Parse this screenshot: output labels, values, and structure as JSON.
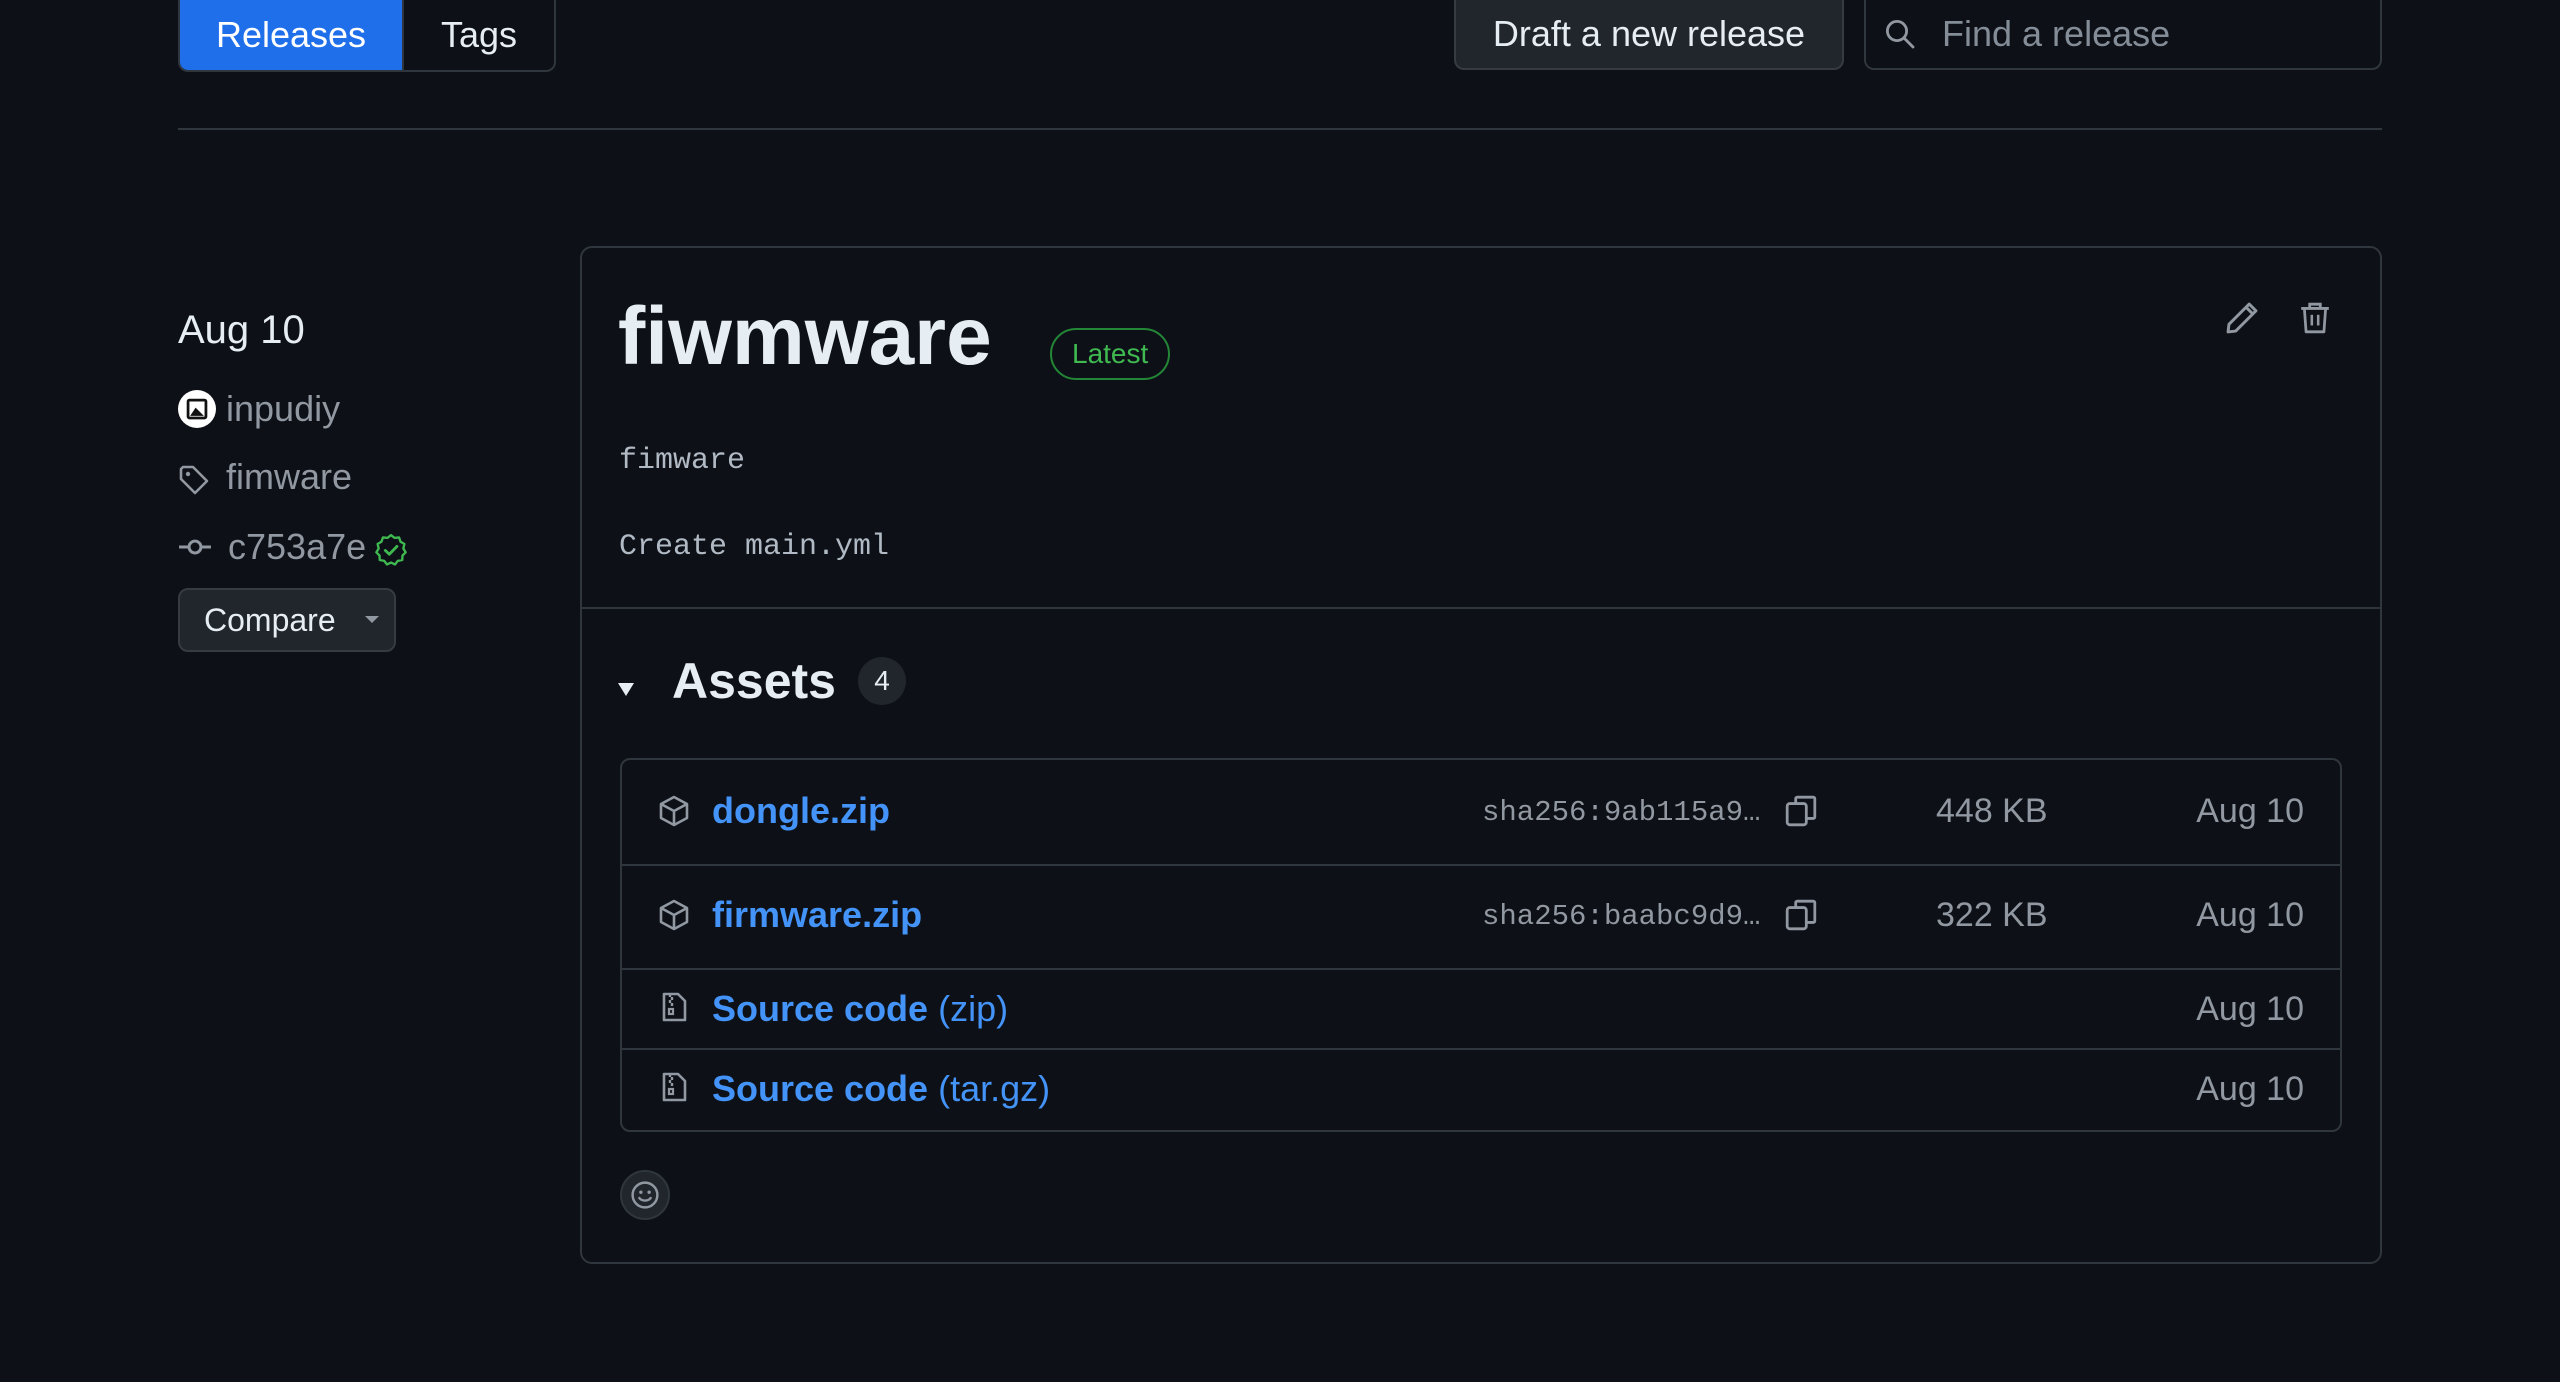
{
  "topbar": {
    "tabs": [
      {
        "label": "Releases",
        "active": true
      },
      {
        "label": "Tags",
        "active": false
      }
    ],
    "draft_button": "Draft a new release",
    "search_placeholder": "Find a release"
  },
  "sidebar": {
    "date": "Aug 10",
    "author": "inpudiy",
    "tag": "fimware",
    "commit": "c753a7e",
    "compare_label": "Compare"
  },
  "release": {
    "title": "fiwmware",
    "badge": "Latest",
    "body_lines": [
      "fimware",
      "Create main.yml"
    ],
    "assets_title": "Assets",
    "assets_count": "4",
    "assets": [
      {
        "name": "dongle.zip",
        "sha": "sha256:9ab115a9…",
        "size": "448 KB",
        "date": "Aug 10"
      },
      {
        "name": "firmware.zip",
        "sha": "sha256:baabc9d9…",
        "size": "322 KB",
        "date": "Aug 10"
      }
    ],
    "sources": [
      {
        "name": "Source code",
        "ext": "(zip)",
        "date": "Aug 10"
      },
      {
        "name": "Source code",
        "ext": "(tar.gz)",
        "date": "Aug 10"
      }
    ]
  },
  "colors": {
    "background": "#0d1117",
    "accent": "#1f6feb",
    "link": "#4493f8",
    "success": "#3fb950",
    "border": "#30363d"
  }
}
